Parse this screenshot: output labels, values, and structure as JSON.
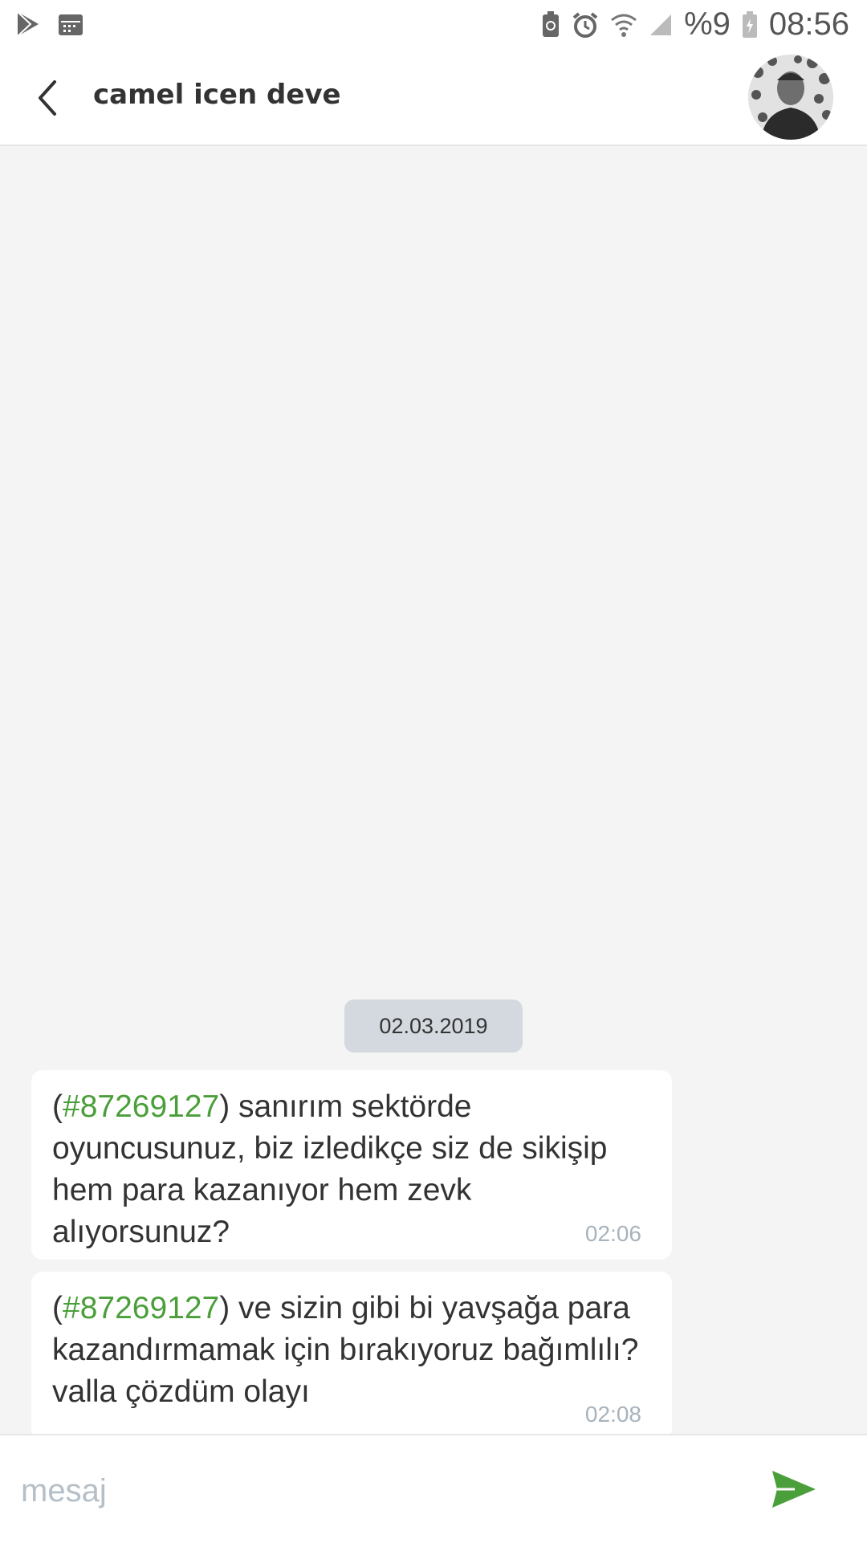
{
  "status_bar": {
    "battery_text": "%9",
    "time": "08:56",
    "icons": [
      "play-store-icon",
      "calendar-icon",
      "battery-saver-icon",
      "alarm-icon",
      "wifi-icon",
      "signal-icon",
      "battery-icon"
    ]
  },
  "header": {
    "title": "camel icen deve",
    "back_icon": "chevron-left-icon"
  },
  "chat": {
    "date": "02.03.2019",
    "messages": [
      {
        "ref": "#87269127",
        "text": "sanırım sektörde oyuncusunuz, biz izledikçe siz de sikişip hem para kazanıyor hem zevk alıyorsunuz?",
        "time": "02:06"
      },
      {
        "ref": "#87269127",
        "text": "ve sizin gibi bi yavşağa para kazandırmamak için bırakıyoruz bağımlılı? valla çözdüm olayı",
        "time": "02:08"
      }
    ]
  },
  "composer": {
    "placeholder": "mesaj",
    "send_icon": "send-icon"
  },
  "colors": {
    "accent_green": "#4a9f3a",
    "chat_background": "#f4f4f4",
    "date_pill": "#d3d9de",
    "timestamp": "#a7b3bd"
  }
}
